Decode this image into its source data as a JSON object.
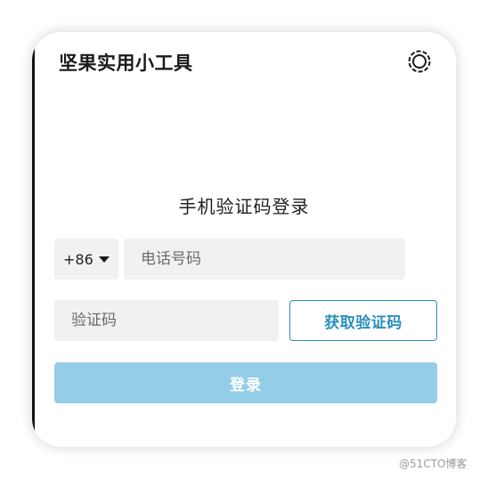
{
  "app": {
    "title": "坚果实用小工具"
  },
  "icons": {
    "settings": "settings-circle-icon",
    "caret": "caret-down-icon"
  },
  "login": {
    "heading": "手机验证码登录",
    "country_code": "+86",
    "phone_placeholder": "电话号码",
    "phone_value": "",
    "code_placeholder": "验证码",
    "code_value": "",
    "get_code_label": "获取验证码",
    "submit_label": "登录"
  },
  "colors": {
    "accent": "#2a8fbf",
    "login_button_disabled": "#94cde8",
    "input_background": "#f0f1f2"
  },
  "watermark": "@51CTO博客"
}
